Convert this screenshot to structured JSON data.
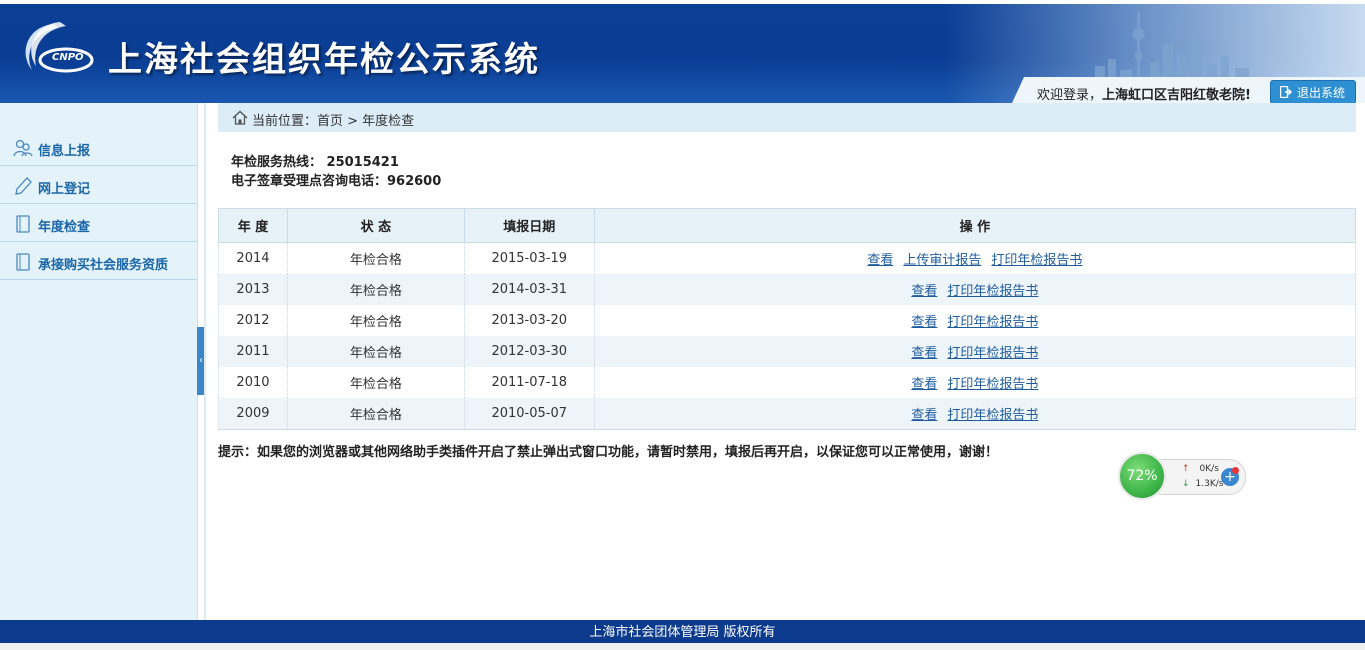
{
  "header": {
    "title": "上海社会组织年检公示系统",
    "logo_text": "CNPO",
    "welcome_prefix": "欢迎登录，",
    "user_name": "上海虹口区吉阳红敬老院!",
    "logout_label": "退出系统"
  },
  "sidebar": {
    "items": [
      {
        "label": "信息上报",
        "icon": "users-icon"
      },
      {
        "label": "网上登记",
        "icon": "pen-icon"
      },
      {
        "label": "年度检查",
        "icon": "document-icon"
      },
      {
        "label": "承接购买社会服务资质",
        "icon": "document-icon"
      }
    ]
  },
  "breadcrumb": {
    "text": "当前位置：首页 > 年度检查"
  },
  "contact": {
    "hotline": "年检服务热线： 25015421",
    "seal_phone": "电子签章受理点咨询电话：962600"
  },
  "table": {
    "headers": [
      "年 度",
      "状 态",
      "填报日期",
      "操 作"
    ],
    "rows": [
      {
        "year": "2014",
        "status": "年检合格",
        "date": "2015-03-19",
        "ops": [
          "查看",
          "上传审计报告",
          "打印年检报告书"
        ]
      },
      {
        "year": "2013",
        "status": "年检合格",
        "date": "2014-03-31",
        "ops": [
          "查看",
          "打印年检报告书"
        ]
      },
      {
        "year": "2012",
        "status": "年检合格",
        "date": "2013-03-20",
        "ops": [
          "查看",
          "打印年检报告书"
        ]
      },
      {
        "year": "2011",
        "status": "年检合格",
        "date": "2012-03-30",
        "ops": [
          "查看",
          "打印年检报告书"
        ]
      },
      {
        "year": "2010",
        "status": "年检合格",
        "date": "2011-07-18",
        "ops": [
          "查看",
          "打印年检报告书"
        ]
      },
      {
        "year": "2009",
        "status": "年检合格",
        "date": "2010-05-07",
        "ops": [
          "查看",
          "打印年检报告书"
        ]
      }
    ]
  },
  "tip": "提示：如果您的浏览器或其他网络助手类插件开启了禁止弹出式窗口功能，请暂时禁用，填报后再开启，以保证您可以正常使用，谢谢！",
  "widget": {
    "percent": "72%",
    "upload": "0K/s",
    "download": "1.3K/s"
  },
  "footer": {
    "text": "上海市社会团体管理局 版权所有"
  },
  "colors": {
    "header_blue": "#0b3e95",
    "sidebar_bg": "#e4f2f9",
    "link": "#1f5c9c",
    "logout_btn": "#2f8fd3"
  }
}
